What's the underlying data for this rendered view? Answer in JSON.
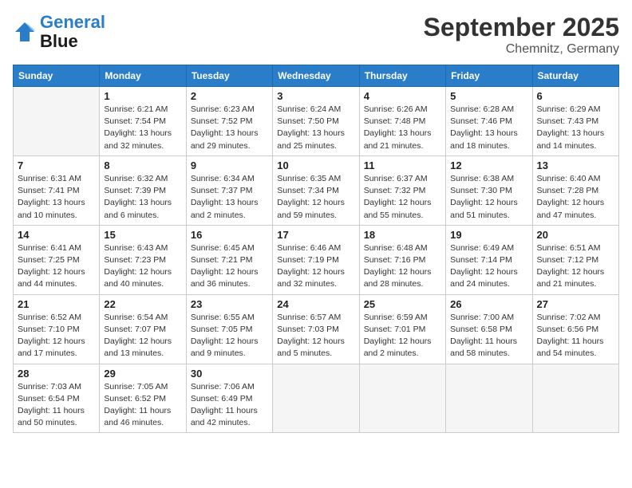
{
  "header": {
    "logo_line1": "General",
    "logo_line2": "Blue",
    "month": "September 2025",
    "location": "Chemnitz, Germany"
  },
  "days_of_week": [
    "Sunday",
    "Monday",
    "Tuesday",
    "Wednesday",
    "Thursday",
    "Friday",
    "Saturday"
  ],
  "weeks": [
    [
      {
        "day": "",
        "sunrise": "",
        "sunset": "",
        "daylight": ""
      },
      {
        "day": "1",
        "sunrise": "Sunrise: 6:21 AM",
        "sunset": "Sunset: 7:54 PM",
        "daylight": "Daylight: 13 hours and 32 minutes."
      },
      {
        "day": "2",
        "sunrise": "Sunrise: 6:23 AM",
        "sunset": "Sunset: 7:52 PM",
        "daylight": "Daylight: 13 hours and 29 minutes."
      },
      {
        "day": "3",
        "sunrise": "Sunrise: 6:24 AM",
        "sunset": "Sunset: 7:50 PM",
        "daylight": "Daylight: 13 hours and 25 minutes."
      },
      {
        "day": "4",
        "sunrise": "Sunrise: 6:26 AM",
        "sunset": "Sunset: 7:48 PM",
        "daylight": "Daylight: 13 hours and 21 minutes."
      },
      {
        "day": "5",
        "sunrise": "Sunrise: 6:28 AM",
        "sunset": "Sunset: 7:46 PM",
        "daylight": "Daylight: 13 hours and 18 minutes."
      },
      {
        "day": "6",
        "sunrise": "Sunrise: 6:29 AM",
        "sunset": "Sunset: 7:43 PM",
        "daylight": "Daylight: 13 hours and 14 minutes."
      }
    ],
    [
      {
        "day": "7",
        "sunrise": "Sunrise: 6:31 AM",
        "sunset": "Sunset: 7:41 PM",
        "daylight": "Daylight: 13 hours and 10 minutes."
      },
      {
        "day": "8",
        "sunrise": "Sunrise: 6:32 AM",
        "sunset": "Sunset: 7:39 PM",
        "daylight": "Daylight: 13 hours and 6 minutes."
      },
      {
        "day": "9",
        "sunrise": "Sunrise: 6:34 AM",
        "sunset": "Sunset: 7:37 PM",
        "daylight": "Daylight: 13 hours and 2 minutes."
      },
      {
        "day": "10",
        "sunrise": "Sunrise: 6:35 AM",
        "sunset": "Sunset: 7:34 PM",
        "daylight": "Daylight: 12 hours and 59 minutes."
      },
      {
        "day": "11",
        "sunrise": "Sunrise: 6:37 AM",
        "sunset": "Sunset: 7:32 PM",
        "daylight": "Daylight: 12 hours and 55 minutes."
      },
      {
        "day": "12",
        "sunrise": "Sunrise: 6:38 AM",
        "sunset": "Sunset: 7:30 PM",
        "daylight": "Daylight: 12 hours and 51 minutes."
      },
      {
        "day": "13",
        "sunrise": "Sunrise: 6:40 AM",
        "sunset": "Sunset: 7:28 PM",
        "daylight": "Daylight: 12 hours and 47 minutes."
      }
    ],
    [
      {
        "day": "14",
        "sunrise": "Sunrise: 6:41 AM",
        "sunset": "Sunset: 7:25 PM",
        "daylight": "Daylight: 12 hours and 44 minutes."
      },
      {
        "day": "15",
        "sunrise": "Sunrise: 6:43 AM",
        "sunset": "Sunset: 7:23 PM",
        "daylight": "Daylight: 12 hours and 40 minutes."
      },
      {
        "day": "16",
        "sunrise": "Sunrise: 6:45 AM",
        "sunset": "Sunset: 7:21 PM",
        "daylight": "Daylight: 12 hours and 36 minutes."
      },
      {
        "day": "17",
        "sunrise": "Sunrise: 6:46 AM",
        "sunset": "Sunset: 7:19 PM",
        "daylight": "Daylight: 12 hours and 32 minutes."
      },
      {
        "day": "18",
        "sunrise": "Sunrise: 6:48 AM",
        "sunset": "Sunset: 7:16 PM",
        "daylight": "Daylight: 12 hours and 28 minutes."
      },
      {
        "day": "19",
        "sunrise": "Sunrise: 6:49 AM",
        "sunset": "Sunset: 7:14 PM",
        "daylight": "Daylight: 12 hours and 24 minutes."
      },
      {
        "day": "20",
        "sunrise": "Sunrise: 6:51 AM",
        "sunset": "Sunset: 7:12 PM",
        "daylight": "Daylight: 12 hours and 21 minutes."
      }
    ],
    [
      {
        "day": "21",
        "sunrise": "Sunrise: 6:52 AM",
        "sunset": "Sunset: 7:10 PM",
        "daylight": "Daylight: 12 hours and 17 minutes."
      },
      {
        "day": "22",
        "sunrise": "Sunrise: 6:54 AM",
        "sunset": "Sunset: 7:07 PM",
        "daylight": "Daylight: 12 hours and 13 minutes."
      },
      {
        "day": "23",
        "sunrise": "Sunrise: 6:55 AM",
        "sunset": "Sunset: 7:05 PM",
        "daylight": "Daylight: 12 hours and 9 minutes."
      },
      {
        "day": "24",
        "sunrise": "Sunrise: 6:57 AM",
        "sunset": "Sunset: 7:03 PM",
        "daylight": "Daylight: 12 hours and 5 minutes."
      },
      {
        "day": "25",
        "sunrise": "Sunrise: 6:59 AM",
        "sunset": "Sunset: 7:01 PM",
        "daylight": "Daylight: 12 hours and 2 minutes."
      },
      {
        "day": "26",
        "sunrise": "Sunrise: 7:00 AM",
        "sunset": "Sunset: 6:58 PM",
        "daylight": "Daylight: 11 hours and 58 minutes."
      },
      {
        "day": "27",
        "sunrise": "Sunrise: 7:02 AM",
        "sunset": "Sunset: 6:56 PM",
        "daylight": "Daylight: 11 hours and 54 minutes."
      }
    ],
    [
      {
        "day": "28",
        "sunrise": "Sunrise: 7:03 AM",
        "sunset": "Sunset: 6:54 PM",
        "daylight": "Daylight: 11 hours and 50 minutes."
      },
      {
        "day": "29",
        "sunrise": "Sunrise: 7:05 AM",
        "sunset": "Sunset: 6:52 PM",
        "daylight": "Daylight: 11 hours and 46 minutes."
      },
      {
        "day": "30",
        "sunrise": "Sunrise: 7:06 AM",
        "sunset": "Sunset: 6:49 PM",
        "daylight": "Daylight: 11 hours and 42 minutes."
      },
      {
        "day": "",
        "sunrise": "",
        "sunset": "",
        "daylight": ""
      },
      {
        "day": "",
        "sunrise": "",
        "sunset": "",
        "daylight": ""
      },
      {
        "day": "",
        "sunrise": "",
        "sunset": "",
        "daylight": ""
      },
      {
        "day": "",
        "sunrise": "",
        "sunset": "",
        "daylight": ""
      }
    ]
  ]
}
